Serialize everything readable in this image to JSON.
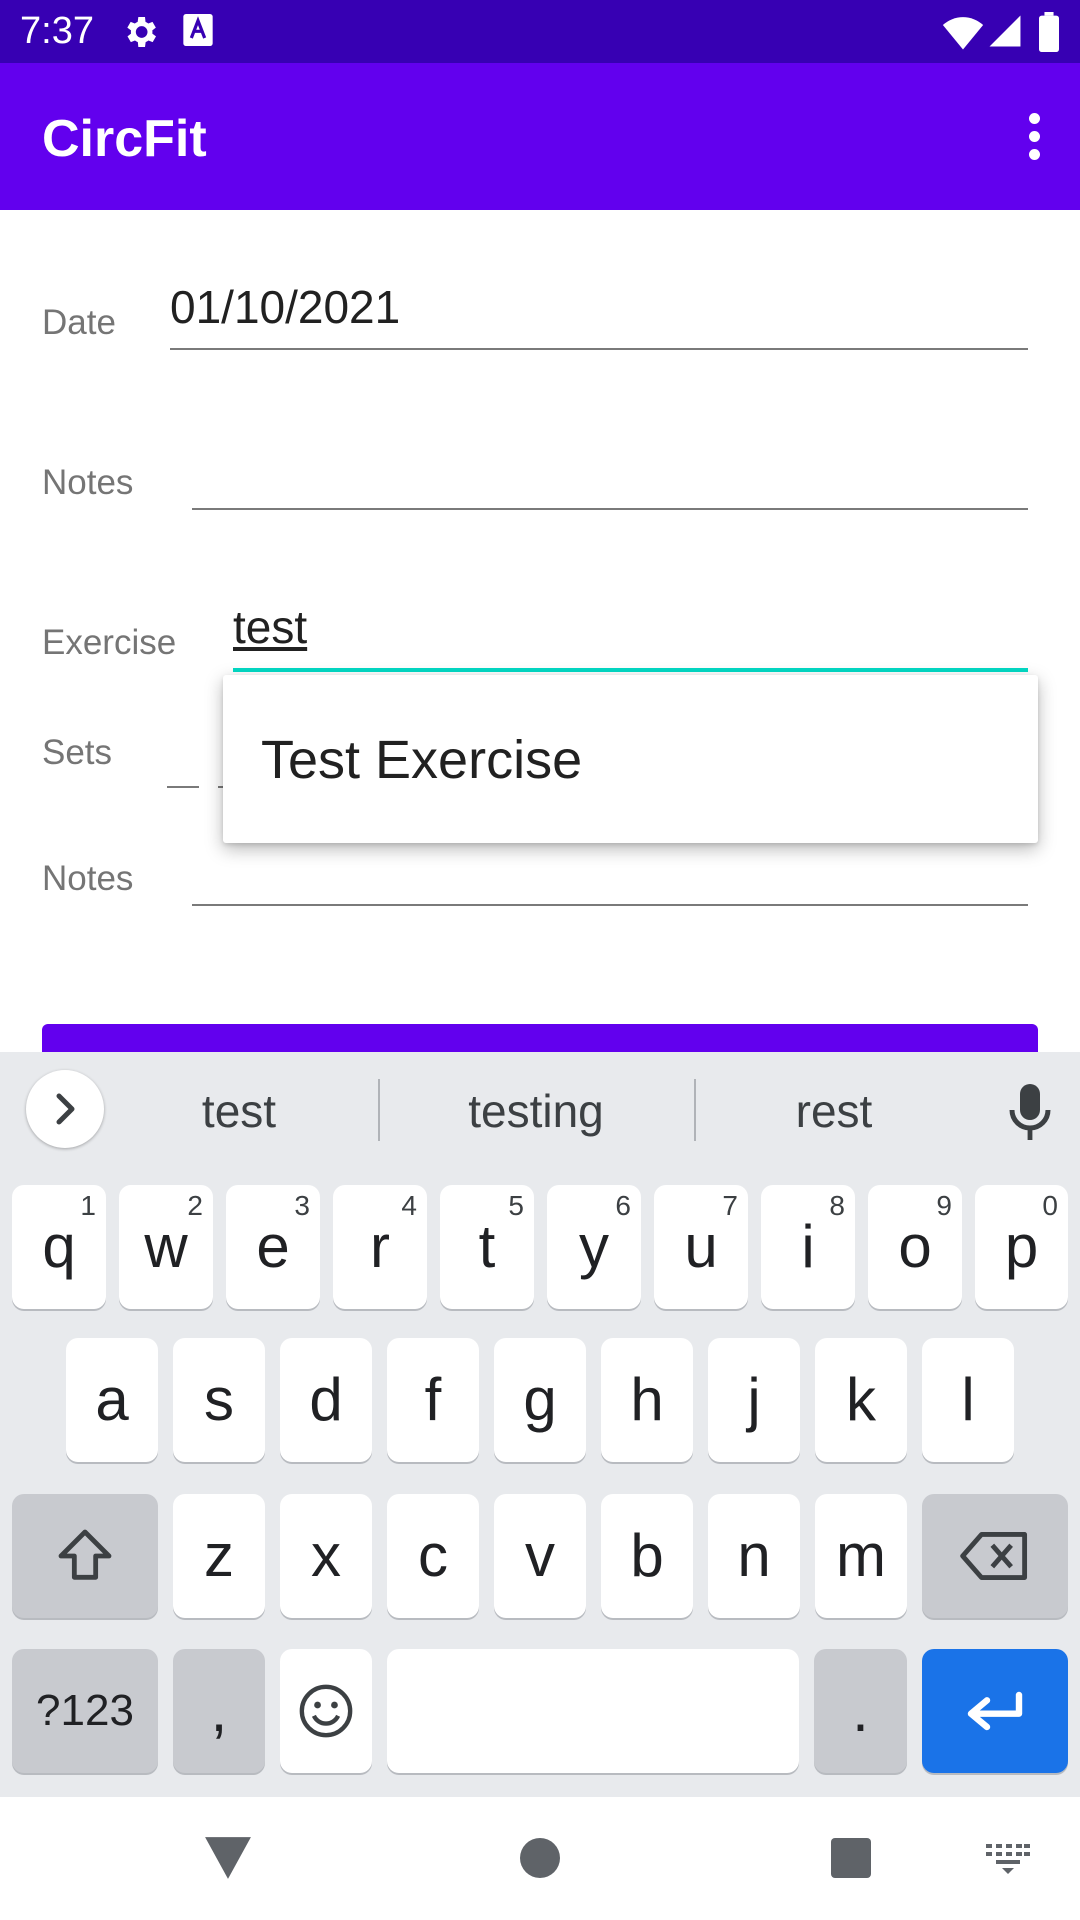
{
  "status_bar": {
    "time": "7:37",
    "icons": [
      "gear-icon",
      "a11y-a-icon",
      "wifi-icon",
      "signal-icon",
      "battery-icon"
    ]
  },
  "app_bar": {
    "title": "CircFit",
    "menu_icon": "more-vert-icon"
  },
  "form": {
    "date_label": "Date",
    "date_value": "01/10/2021",
    "notes_label": "Notes",
    "notes_value": "",
    "exercise_label": "Exercise",
    "exercise_value": "test",
    "sets_label": "Sets",
    "exercise_notes_label": "Notes",
    "exercise_notes_value": ""
  },
  "dropdown": {
    "items": [
      "Test Exercise"
    ]
  },
  "keyboard": {
    "suggestions": [
      "test",
      "testing",
      "rest"
    ],
    "row1": [
      {
        "k": "q",
        "n": "1"
      },
      {
        "k": "w",
        "n": "2"
      },
      {
        "k": "e",
        "n": "3"
      },
      {
        "k": "r",
        "n": "4"
      },
      {
        "k": "t",
        "n": "5"
      },
      {
        "k": "y",
        "n": "6"
      },
      {
        "k": "u",
        "n": "7"
      },
      {
        "k": "i",
        "n": "8"
      },
      {
        "k": "o",
        "n": "9"
      },
      {
        "k": "p",
        "n": "0"
      }
    ],
    "row2": [
      "a",
      "s",
      "d",
      "f",
      "g",
      "h",
      "j",
      "k",
      "l"
    ],
    "row3": [
      "z",
      "x",
      "c",
      "v",
      "b",
      "n",
      "m"
    ],
    "symbols_label": "?123",
    "comma": ",",
    "period": ".",
    "colors": {
      "enter": "#1a73e8",
      "accent": "#03dac5",
      "primary": "#6200ee",
      "primary_dark": "#3700b3"
    }
  },
  "nav_bar": {
    "icons": [
      "back-icon",
      "home-icon",
      "recents-icon",
      "keyboard-switch-icon"
    ]
  }
}
